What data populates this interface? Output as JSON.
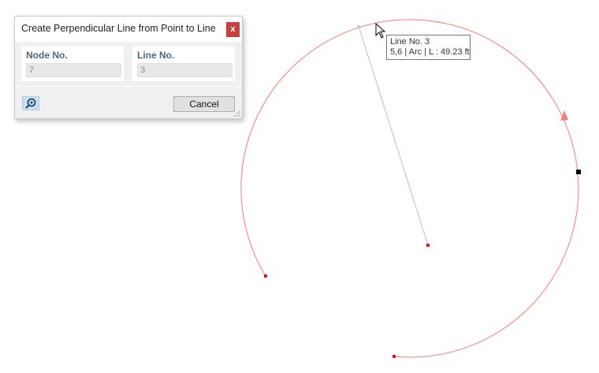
{
  "dialog": {
    "title": "Create Perpendicular Line from Point to Line",
    "close_label": "x",
    "node_label": "Node No.",
    "node_value": "7",
    "line_label": "Line No.",
    "line_value": "3",
    "cancel_label": "Cancel",
    "tool_icon": "pick-icon"
  },
  "tooltip": {
    "line1": "Line No. 3",
    "line2": "5,6 | Arc | L : 49.23 ft"
  },
  "colors": {
    "arc": "#f47c7c",
    "node": "#e31a1c",
    "selected_node": "#000000",
    "perpendicular_line": "#c8c8c8"
  }
}
